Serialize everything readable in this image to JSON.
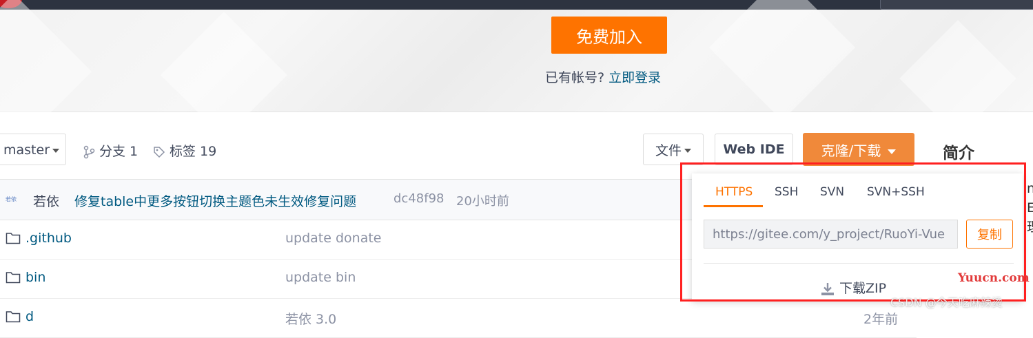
{
  "hero": {
    "join_label": "免费加入",
    "has_account_text": "已有帐号?",
    "login_link": "立即登录"
  },
  "toolbar": {
    "branch": "master",
    "branches_label": "分支 1",
    "tags_label": "标签 19",
    "files_label": "文件",
    "webide_label": "Web IDE",
    "clone_label": "克隆/下载",
    "intro_title": "简介"
  },
  "commit": {
    "avatar_text": "若依",
    "author": "若依",
    "message": "修复table中更多按钮切换主题色未生效修复问题",
    "hash": "dc48f98",
    "time": "20小时前"
  },
  "files": [
    {
      "name": ".github",
      "message": "update donate",
      "time": ""
    },
    {
      "name": "bin",
      "message": "update bin",
      "time": ""
    },
    {
      "name": "d",
      "message": "若依 3.0",
      "time": "2年前"
    }
  ],
  "clone_dropdown": {
    "tabs": [
      "HTTPS",
      "SSH",
      "SVN",
      "SVN+SSH"
    ],
    "active_tab": "HTTPS",
    "url_value": "https://gitee.com/y_project/RuoYi-Vue",
    "copy_label": "复制",
    "download_zip_label": "下载ZIP"
  },
  "right_clip": [
    "ng",
    "E",
    "理"
  ],
  "watermarks": {
    "site": "Yuucn.com",
    "csdn": "CSDN @今天吃麻辣烫"
  },
  "colors": {
    "accent_orange": "#fe7300",
    "clone_button": "#f0893a",
    "link_blue": "#005980",
    "highlight_red": "#ff2020",
    "topbar": "#2d3340"
  }
}
